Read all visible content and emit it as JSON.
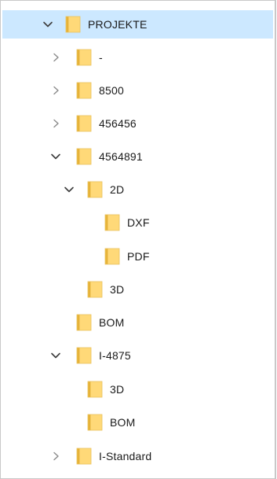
{
  "tree": {
    "nodes": [
      {
        "name": "tree-item-projekte",
        "label": "PROJEKTE",
        "depth": 0,
        "state": "expanded",
        "selected": true
      },
      {
        "name": "tree-item-dash",
        "label": "-",
        "depth": 1,
        "state": "collapsed"
      },
      {
        "name": "tree-item-8500",
        "label": "8500",
        "depth": 1,
        "state": "collapsed"
      },
      {
        "name": "tree-item-456456",
        "label": "456456",
        "depth": 1,
        "state": "collapsed"
      },
      {
        "name": "tree-item-4564891",
        "label": "4564891",
        "depth": 1,
        "state": "expanded"
      },
      {
        "name": "tree-item-2d",
        "label": "2D",
        "depth": 2,
        "state": "expanded"
      },
      {
        "name": "tree-item-dxf",
        "label": "DXF",
        "depth": 3,
        "state": "leaf"
      },
      {
        "name": "tree-item-pdf",
        "label": "PDF",
        "depth": 3,
        "state": "leaf"
      },
      {
        "name": "tree-item-3d",
        "label": "3D",
        "depth": 2,
        "state": "leaf"
      },
      {
        "name": "tree-item-bom",
        "label": "BOM",
        "depth": 1,
        "state": "leaf"
      },
      {
        "name": "tree-item-i-4875",
        "label": "I-4875",
        "depth": 1,
        "state": "expanded"
      },
      {
        "name": "tree-item-i-4875-3d",
        "label": "3D",
        "depth": 2,
        "state": "leaf"
      },
      {
        "name": "tree-item-i-4875-bom",
        "label": "BOM",
        "depth": 2,
        "state": "leaf"
      },
      {
        "name": "tree-item-i-standard",
        "label": "I-Standard",
        "depth": 1,
        "state": "collapsed"
      }
    ]
  },
  "colors": {
    "selection": "#cce8ff",
    "folder_fill": "#ffd978",
    "folder_dark": "#e8b53b",
    "chevron": "#8a8a8a",
    "chevron_expanded": "#3c3c3c"
  }
}
